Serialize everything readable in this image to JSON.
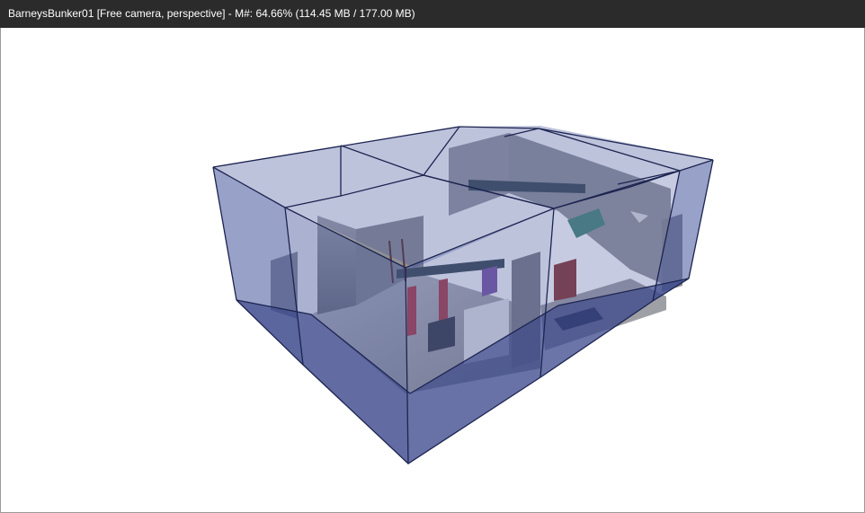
{
  "window": {
    "title": "BarneysBunker01 [Free camera, perspective] - M#: 64.66% (114.45 MB / 177.00 MB)"
  },
  "viewport": {
    "camera_mode": "Free camera, perspective",
    "colors": {
      "box_fill": "#44549a",
      "box_edge": "#1c2450",
      "wall": "#8d8f95",
      "floor": "#b3b4b8",
      "pipe": "#3d4c55",
      "accent_red": "#b0404a",
      "accent_green": "#4a8a7a"
    }
  }
}
